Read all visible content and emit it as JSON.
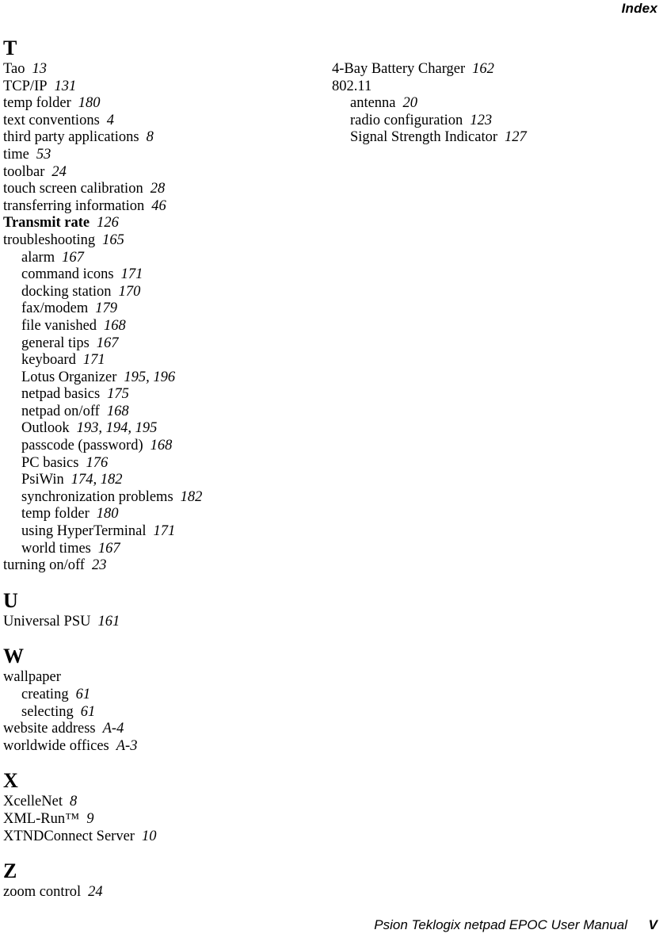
{
  "header": {
    "title": "Index"
  },
  "footer": {
    "manual_title": "Psion Teklogix netpad EPOC User Manual",
    "page_number": "V"
  },
  "columns": {
    "left": [
      {
        "letter": "T",
        "entries": [
          {
            "level": 1,
            "term": "Tao",
            "pages": "13"
          },
          {
            "level": 1,
            "term": "TCP/IP",
            "pages": "131"
          },
          {
            "level": 1,
            "term": "temp folder",
            "pages": "180"
          },
          {
            "level": 1,
            "term": "text conventions",
            "pages": "4"
          },
          {
            "level": 1,
            "term": "third party applications",
            "pages": "8"
          },
          {
            "level": 1,
            "term": "time",
            "pages": "53"
          },
          {
            "level": 1,
            "term": "toolbar",
            "pages": "24"
          },
          {
            "level": 1,
            "term": "touch screen calibration",
            "pages": "28"
          },
          {
            "level": 1,
            "term": "transferring information",
            "pages": "46"
          },
          {
            "level": 1,
            "term": "Transmit rate",
            "pages": "126",
            "bold": true
          },
          {
            "level": 1,
            "term": "troubleshooting",
            "pages": "165"
          },
          {
            "level": 2,
            "term": "alarm",
            "pages": "167"
          },
          {
            "level": 2,
            "term": "command icons",
            "pages": "171"
          },
          {
            "level": 2,
            "term": "docking station",
            "pages": "170"
          },
          {
            "level": 2,
            "term": "fax/modem",
            "pages": "179"
          },
          {
            "level": 2,
            "term": "file vanished",
            "pages": "168"
          },
          {
            "level": 2,
            "term": "general tips",
            "pages": "167"
          },
          {
            "level": 2,
            "term": "keyboard",
            "pages": "171"
          },
          {
            "level": 2,
            "term": "Lotus Organizer",
            "pages": "195, 196"
          },
          {
            "level": 2,
            "term": "netpad basics",
            "pages": "175"
          },
          {
            "level": 2,
            "term": "netpad on/off",
            "pages": "168"
          },
          {
            "level": 2,
            "term": "Outlook",
            "pages": "193, 194, 195"
          },
          {
            "level": 2,
            "term": "passcode (password)",
            "pages": "168"
          },
          {
            "level": 2,
            "term": "PC basics",
            "pages": "176"
          },
          {
            "level": 2,
            "term": "PsiWin",
            "pages": "174, 182"
          },
          {
            "level": 2,
            "term": "synchronization problems",
            "pages": "182"
          },
          {
            "level": 2,
            "term": "temp folder",
            "pages": "180"
          },
          {
            "level": 2,
            "term": "using HyperTerminal",
            "pages": "171"
          },
          {
            "level": 2,
            "term": "world times",
            "pages": "167"
          },
          {
            "level": 1,
            "term": "turning on/off",
            "pages": "23"
          }
        ]
      },
      {
        "letter": "U",
        "entries": [
          {
            "level": 1,
            "term": "Universal PSU",
            "pages": "161"
          }
        ]
      },
      {
        "letter": "W",
        "entries": [
          {
            "level": 1,
            "term": "wallpaper",
            "pages": ""
          },
          {
            "level": 2,
            "term": "creating",
            "pages": "61"
          },
          {
            "level": 2,
            "term": "selecting",
            "pages": "61"
          },
          {
            "level": 1,
            "term": "website address",
            "pages": "A-4"
          },
          {
            "level": 1,
            "term": "worldwide offices",
            "pages": "A-3"
          }
        ]
      },
      {
        "letter": "X",
        "entries": [
          {
            "level": 1,
            "term": "XcelleNet",
            "pages": "8"
          },
          {
            "level": 1,
            "term": "XML-Run™",
            "pages": "9"
          },
          {
            "level": 1,
            "term": "XTNDConnect Server",
            "pages": "10"
          }
        ]
      },
      {
        "letter": "Z",
        "entries": [
          {
            "level": 1,
            "term": "zoom control",
            "pages": "24"
          }
        ]
      }
    ],
    "right": [
      {
        "letter": "",
        "entries": [
          {
            "level": 1,
            "term": "4-Bay Battery Charger",
            "pages": "162"
          },
          {
            "level": 1,
            "term": "802.11",
            "pages": ""
          },
          {
            "level": 2,
            "term": "antenna",
            "pages": "20"
          },
          {
            "level": 2,
            "term": "radio configuration",
            "pages": "123"
          },
          {
            "level": 2,
            "term": "Signal Strength Indicator",
            "pages": "127"
          }
        ]
      }
    ]
  }
}
